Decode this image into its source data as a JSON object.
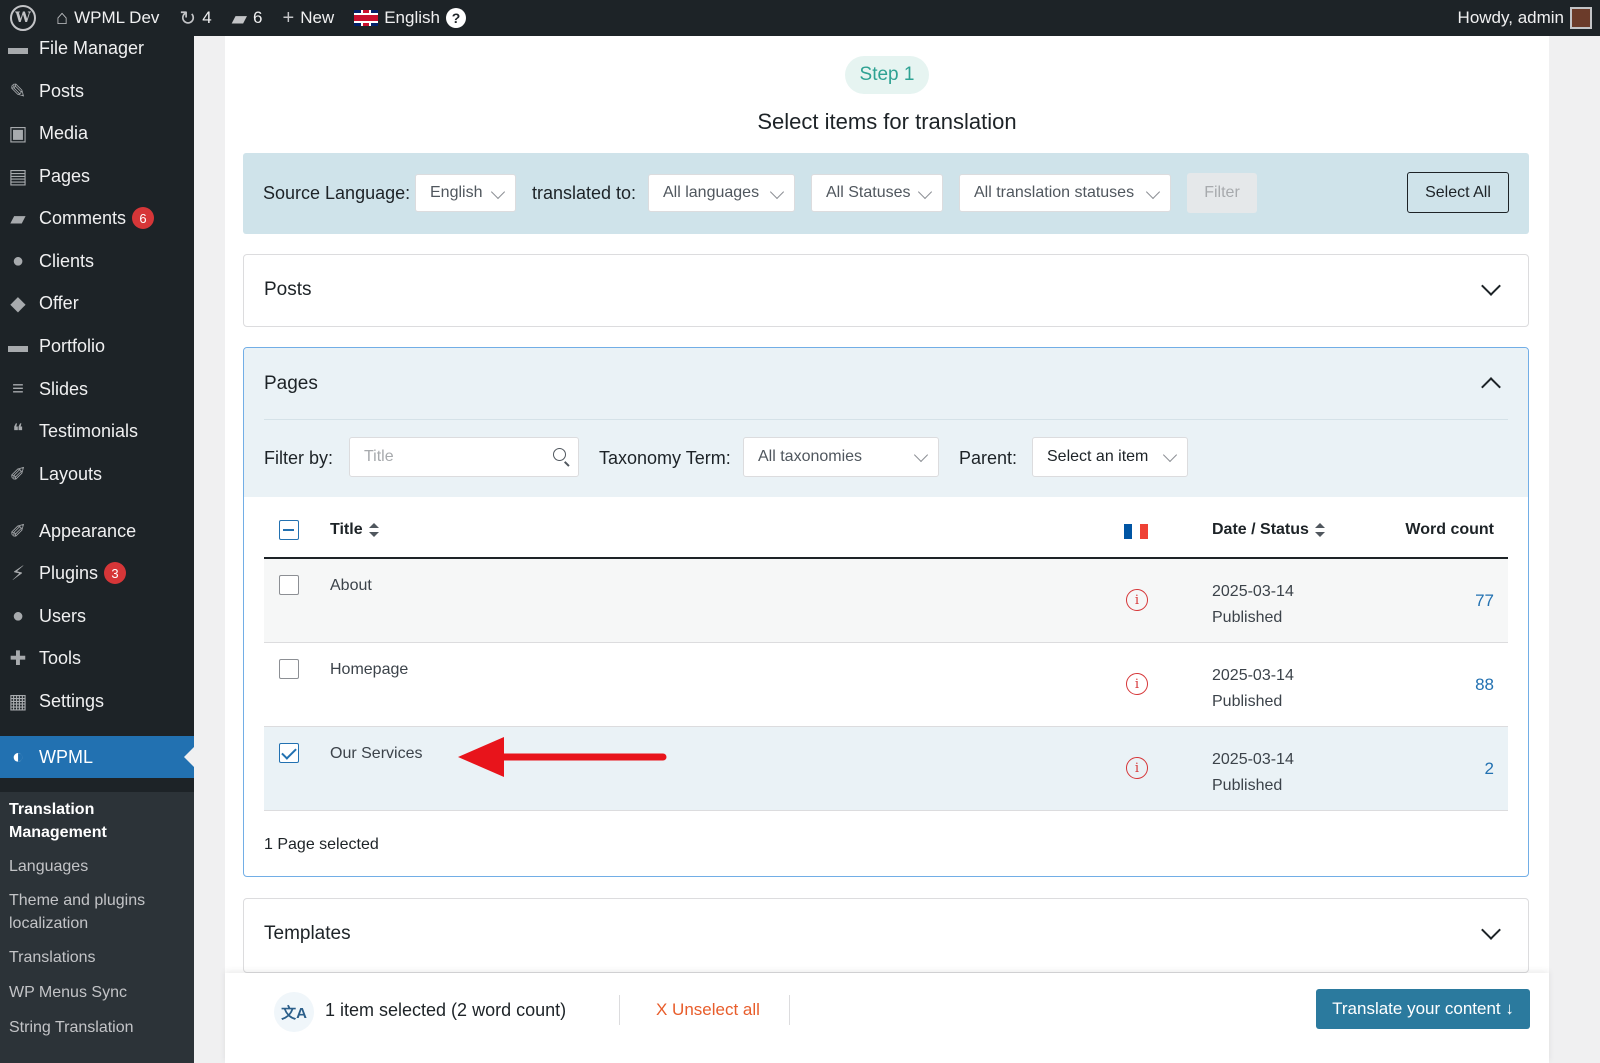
{
  "adminbar": {
    "site_name": "WPML Dev",
    "updates_count": "4",
    "comments_count": "6",
    "new_label": "New",
    "language": "English",
    "help_glyph": "?",
    "greeting": "Howdy, admin"
  },
  "sidebar": {
    "items": [
      {
        "label": "File Manager",
        "icon": "folder-icon"
      },
      {
        "label": "Posts",
        "icon": "pin-icon"
      },
      {
        "label": "Media",
        "icon": "media-icon"
      },
      {
        "label": "Pages",
        "icon": "page-icon"
      },
      {
        "label": "Comments",
        "icon": "comment-icon",
        "badge": "6"
      },
      {
        "label": "Clients",
        "icon": "user-icon"
      },
      {
        "label": "Offer",
        "icon": "tag-icon"
      },
      {
        "label": "Portfolio",
        "icon": "folder-icon"
      },
      {
        "label": "Slides",
        "icon": "slides-icon"
      },
      {
        "label": "Testimonials",
        "icon": "quote-icon"
      },
      {
        "label": "Layouts",
        "icon": "brush-icon"
      },
      {
        "label": "Appearance",
        "icon": "brush-icon"
      },
      {
        "label": "Plugins",
        "icon": "plugin-icon",
        "badge": "3"
      },
      {
        "label": "Users",
        "icon": "user-icon"
      },
      {
        "label": "Tools",
        "icon": "wrench-icon"
      },
      {
        "label": "Settings",
        "icon": "settings-icon"
      },
      {
        "label": "WPML",
        "icon": "wpml-icon"
      }
    ],
    "submenu": [
      "Translation Management",
      "Languages",
      "Theme and plugins localization",
      "Translations",
      "WP Menus Sync",
      "String Translation"
    ]
  },
  "main": {
    "step": "Step 1",
    "title": "Select items for translation",
    "filters": {
      "source_label": "Source Language:",
      "source_value": "English",
      "translated_label": "translated to:",
      "languages_value": "All languages",
      "statuses_value": "All Statuses",
      "translation_statuses_value": "All translation statuses",
      "filter_button": "Filter",
      "select_all_button": "Select All"
    },
    "sections": {
      "posts": "Posts",
      "pages": "Pages",
      "templates": "Templates"
    },
    "pages": {
      "filter_by_label": "Filter by:",
      "title_placeholder": "Title",
      "taxonomy_label": "Taxonomy Term:",
      "taxonomy_value": "All taxonomies",
      "parent_label": "Parent:",
      "parent_value": "Select an item",
      "columns": {
        "title": "Title",
        "date_status": "Date / Status",
        "word_count": "Word count"
      },
      "rows": [
        {
          "title": "About",
          "date": "2025-03-14",
          "status": "Published",
          "word_count": "77",
          "checked": false
        },
        {
          "title": "Homepage",
          "date": "2025-03-14",
          "status": "Published",
          "word_count": "88",
          "checked": false
        },
        {
          "title": "Our Services",
          "date": "2025-03-14",
          "status": "Published",
          "word_count": "2",
          "checked": true
        }
      ],
      "selected_summary": "1 Page selected"
    }
  },
  "bottom_bar": {
    "selected_text": "1 item selected (2 word count)",
    "unselect_all": "X Unselect all",
    "translate_button": "Translate your content ↓"
  },
  "colors": {
    "accent": "#2271b1",
    "annotation_arrow": "#e8141b",
    "translate_button": "#2b7a9e"
  }
}
